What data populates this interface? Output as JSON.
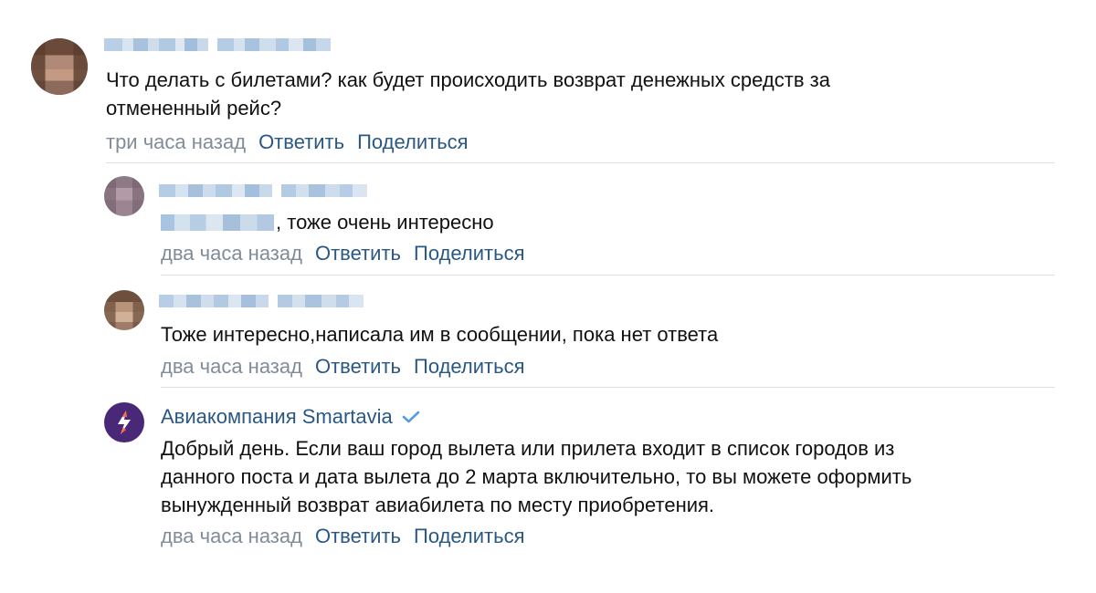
{
  "comments": [
    {
      "text": "Что делать с билетами? как будет происходить возврат денежных средств за\nотмененный рейс?",
      "time": "три часа назад",
      "reply_label": "Ответить",
      "share_label": "Поделиться"
    },
    {
      "text": "тоже очень интересно",
      "time": "два часа назад",
      "reply_label": "Ответить",
      "share_label": "Поделиться"
    },
    {
      "text": "Тоже интересно,написала им в сообщении, пока нет ответа",
      "time": "два часа назад",
      "reply_label": "Ответить",
      "share_label": "Поделиться"
    },
    {
      "author": "Авиакомпания Smartavia",
      "verified_icon": "check-icon",
      "text": "Добрый день. Если ваш город вылета или прилета входит в список городов из\nданного поста и дата вылета до 2 марта включительно, то вы можете оформить\nвынужденный возврат авиабилета по месту приобретения.",
      "time": "два часа назад",
      "reply_label": "Ответить",
      "share_label": "Поделиться"
    }
  ],
  "colors": {
    "link": "#2a5885",
    "muted": "#818c99",
    "divider": "#dce1e6",
    "brand_logo": "#4a2878",
    "verified": "#5b9be6"
  }
}
